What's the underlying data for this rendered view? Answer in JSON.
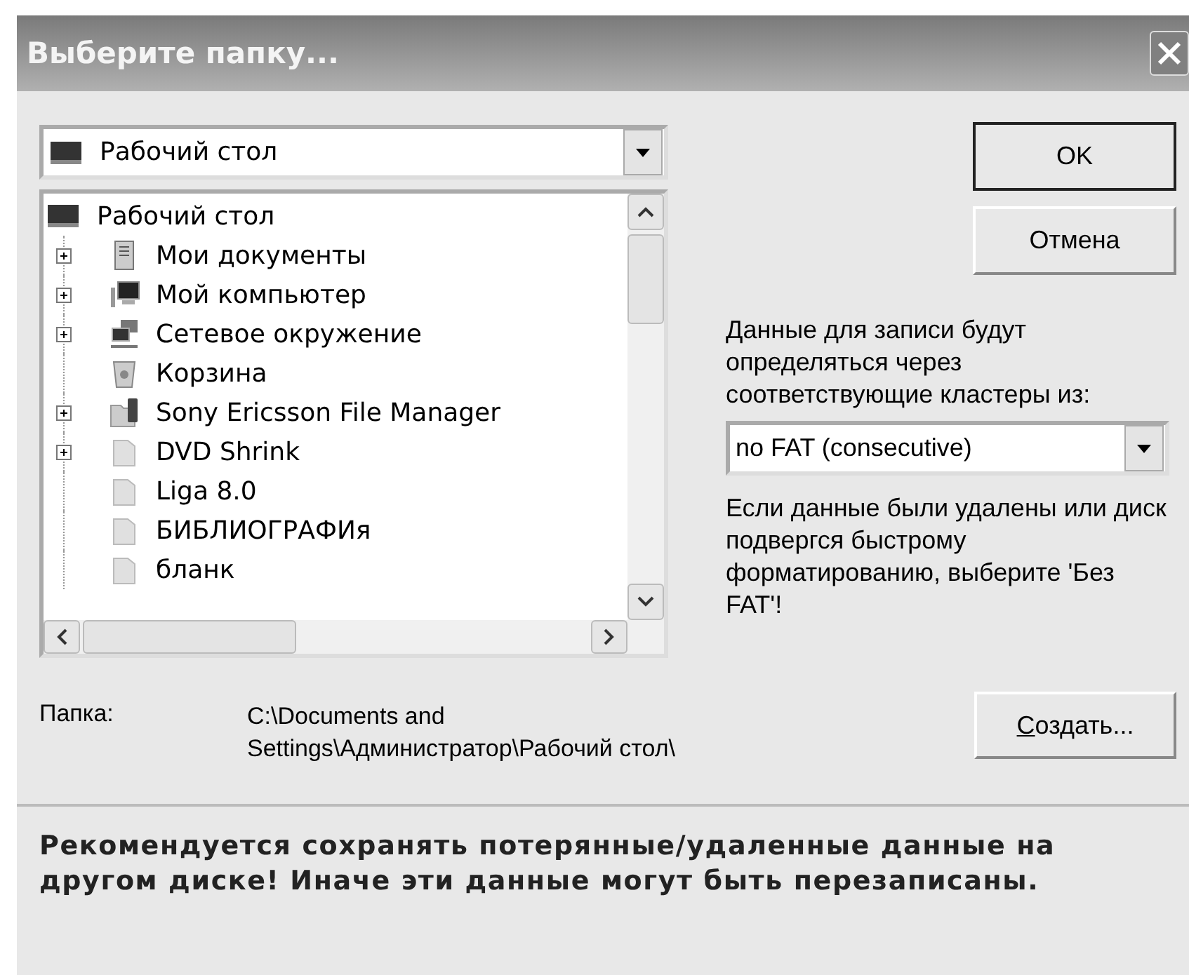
{
  "window": {
    "title": "Выберите папку..."
  },
  "location_combo": {
    "value": "Рабочий стол",
    "kind": "desktop"
  },
  "tree": {
    "label": "Рабочий стол",
    "kind": "desktop",
    "children": [
      {
        "label": "Мои документы",
        "kind": "documents",
        "expanded": false
      },
      {
        "label": "Мой компьютер",
        "kind": "computer",
        "expanded": false
      },
      {
        "label": "Сетевое окружение",
        "kind": "network",
        "expanded": false
      },
      {
        "label": "Корзина",
        "kind": "recycle-bin"
      },
      {
        "label": "Sony Ericsson File Manager",
        "kind": "phone-folder",
        "expanded": false
      },
      {
        "label": "DVD Shrink",
        "kind": "folder",
        "expanded": false
      },
      {
        "label": "Liga 8.0",
        "kind": "folder"
      },
      {
        "label": "БИБЛИОГРАФИя",
        "kind": "folder"
      },
      {
        "label": "бланк",
        "kind": "folder"
      }
    ]
  },
  "buttons": [
    {
      "label": "OK",
      "default": true
    },
    {
      "label": "Отмена",
      "default": false
    }
  ],
  "cluster_label": "Данные для записи будут определяться через соответствующие кластеры из:",
  "cluster_combo": {
    "value": "no FAT (consecutive)"
  },
  "hint": "Если данные были удалены или диск подвергся быстрому форматированию, выберите 'Без FAT'!",
  "folder": {
    "label": "Папка:",
    "path": "C:\\Documents and Settings\\Администратор\\Рабочий стол\\"
  },
  "create_button": {
    "label": "Создать..."
  },
  "warning": "Рекомендуется сохранять потерянные/удаленные данные на другом диске! Иначе эти данные могут быть перезаписаны."
}
